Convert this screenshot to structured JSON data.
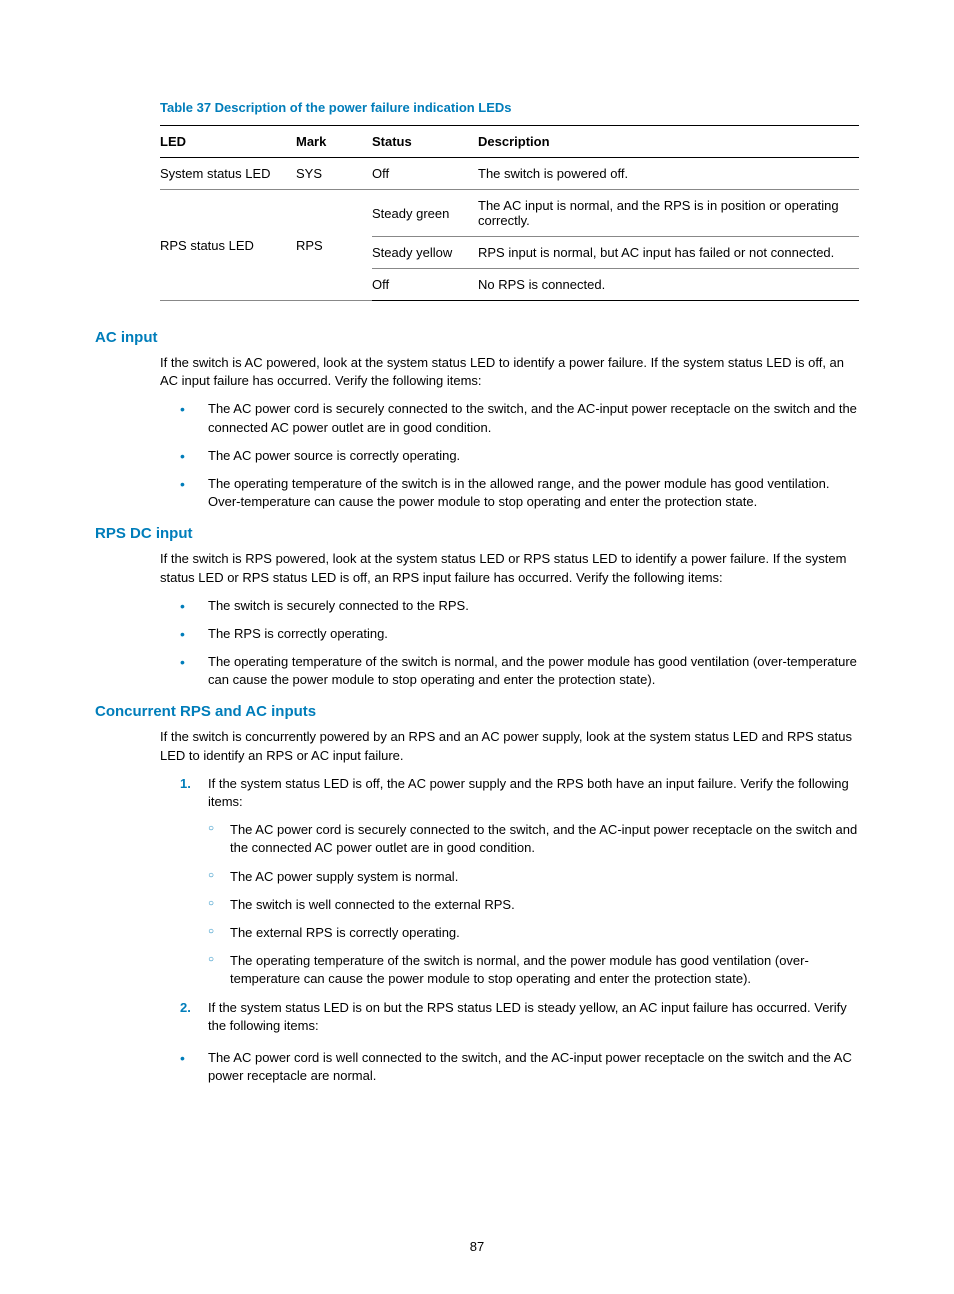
{
  "tableCaption": "Table 37 Description of the power failure indication LEDs",
  "headers": {
    "led": "LED",
    "mark": "Mark",
    "status": "Status",
    "desc": "Description"
  },
  "rows": {
    "r1": {
      "led": "System status LED",
      "mark": "SYS",
      "status": "Off",
      "desc": "The switch is powered off."
    },
    "r2": {
      "led": "RPS status LED",
      "mark": "RPS",
      "status": "Steady green",
      "desc": "The AC input is normal, and the RPS is in position or operating correctly."
    },
    "r3": {
      "status": "Steady yellow",
      "desc": "RPS input is normal, but AC input has failed or not connected."
    },
    "r4": {
      "status": "Off",
      "desc": "No RPS is connected."
    }
  },
  "sections": {
    "ac": {
      "title": "AC input",
      "intro": "If the switch is AC powered, look at the system status LED to identify a power failure. If the system status LED is off, an AC input failure has occurred. Verify the following items:",
      "items": [
        "The AC power cord is securely connected to the switch, and the AC-input power receptacle on the switch and the connected AC power outlet are in good condition.",
        "The AC power source is correctly operating.",
        "The operating temperature of the switch is in the allowed range, and the power module has good ventilation. Over-temperature can cause the power module to stop operating and enter the protection state."
      ]
    },
    "rps": {
      "title": "RPS DC input",
      "intro": "If the switch is RPS powered, look at the system status LED or RPS status LED to identify a power failure. If the system status LED or RPS status LED is off, an RPS input failure has occurred. Verify the following items:",
      "items": [
        "The switch is securely connected to the RPS.",
        "The RPS is correctly operating.",
        "The operating temperature of the switch is normal, and the power module has good ventilation (over-temperature can cause the power module to stop operating and enter the protection state)."
      ]
    },
    "both": {
      "title": "Concurrent RPS and AC inputs",
      "intro": "If the switch is concurrently powered by an RPS and an AC power supply, look at the system status LED and RPS status LED to identify an RPS or AC input failure.",
      "num1": {
        "marker": "1.",
        "text": "If the system status LED is off, the AC power supply and the RPS both have an input failure. Verify the following items:",
        "subs": [
          "The AC power cord is securely connected to the switch, and the AC-input power receptacle on the switch and the connected AC power outlet are in good condition.",
          "The AC power supply system is normal.",
          "The switch is well connected to the external RPS.",
          "The external RPS is correctly operating.",
          "The operating temperature of the switch is normal, and the power module has good ventilation (over-temperature can cause the power module to stop operating and enter the protection state)."
        ]
      },
      "num2": {
        "marker": "2.",
        "text": "If the system status LED is on but the RPS status LED is steady yellow, an AC input failure has occurred. Verify the following items:"
      },
      "tail": "The AC power cord is well connected to the switch, and the AC-input power receptacle on the switch and the AC power receptacle are normal."
    }
  },
  "pageNumber": "87"
}
